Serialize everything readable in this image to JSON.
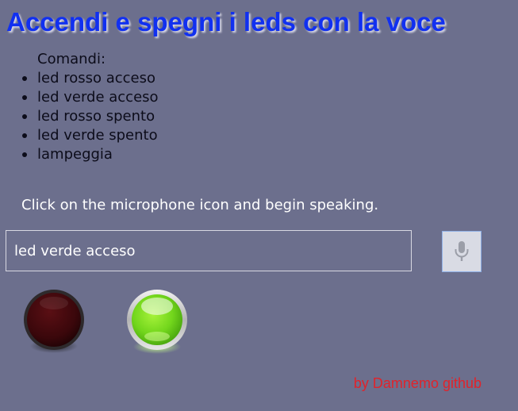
{
  "title": "Accendi e spegni i leds con la voce",
  "commands": {
    "heading": "Comandi:",
    "items": [
      "led rosso acceso",
      "led verde acceso",
      "led rosso spento",
      "led verde spento",
      "lampeggia"
    ]
  },
  "instructions": "Click on the microphone icon and begin speaking.",
  "speech_input": {
    "value": "led verde acceso"
  },
  "mic_button": {
    "icon": "microphone-icon"
  },
  "leds": {
    "red": {
      "state": "off",
      "color": "#4a0c10"
    },
    "green": {
      "state": "on",
      "color": "#7fe021"
    }
  },
  "credit": "by Damnemo github",
  "colors": {
    "background": "#6c6f8d",
    "title": "#1130f0",
    "credit": "#e0232b"
  }
}
